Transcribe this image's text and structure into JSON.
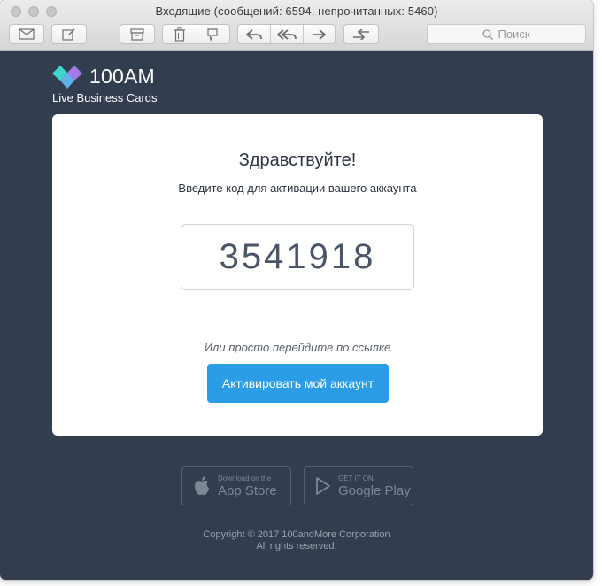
{
  "window": {
    "title": "Входящие (сообщений: 6594, непрочитанных: 5460)"
  },
  "toolbar": {
    "buttons": [
      {
        "icon": "envelope-icon"
      },
      {
        "icon": "compose-icon"
      },
      {
        "icon": "archive-icon"
      },
      {
        "icon": "trash-icon"
      },
      {
        "icon": "junk-icon"
      },
      {
        "icon": "reply-icon"
      },
      {
        "icon": "reply-all-icon"
      },
      {
        "icon": "forward-icon"
      },
      {
        "icon": "flag-icon"
      }
    ],
    "search_placeholder": "Поиск"
  },
  "email": {
    "brand_name": "100AM",
    "brand_tagline": "Live Business Cards",
    "greeting": "Здравствуйте!",
    "instruction": "Введите код для активации вашего аккаунта",
    "activation_code": "3541918",
    "alt_text": "Или просто перейдите по ссылке",
    "activate_button": "Активировать мой аккаунт",
    "stores": {
      "appstore_small": "Download on the",
      "appstore_big": "App Store",
      "googleplay_small": "GET IT ON",
      "googleplay_big": "Google Play"
    },
    "copyright_line1": "Copyright © 2017 100andMore Corporation",
    "copyright_line2": "All rights reserved."
  },
  "colors": {
    "background": "#323d4f",
    "button": "#2b9ce6",
    "logo_teal": "#3fd7c8",
    "logo_purple": "#a47ae6"
  }
}
